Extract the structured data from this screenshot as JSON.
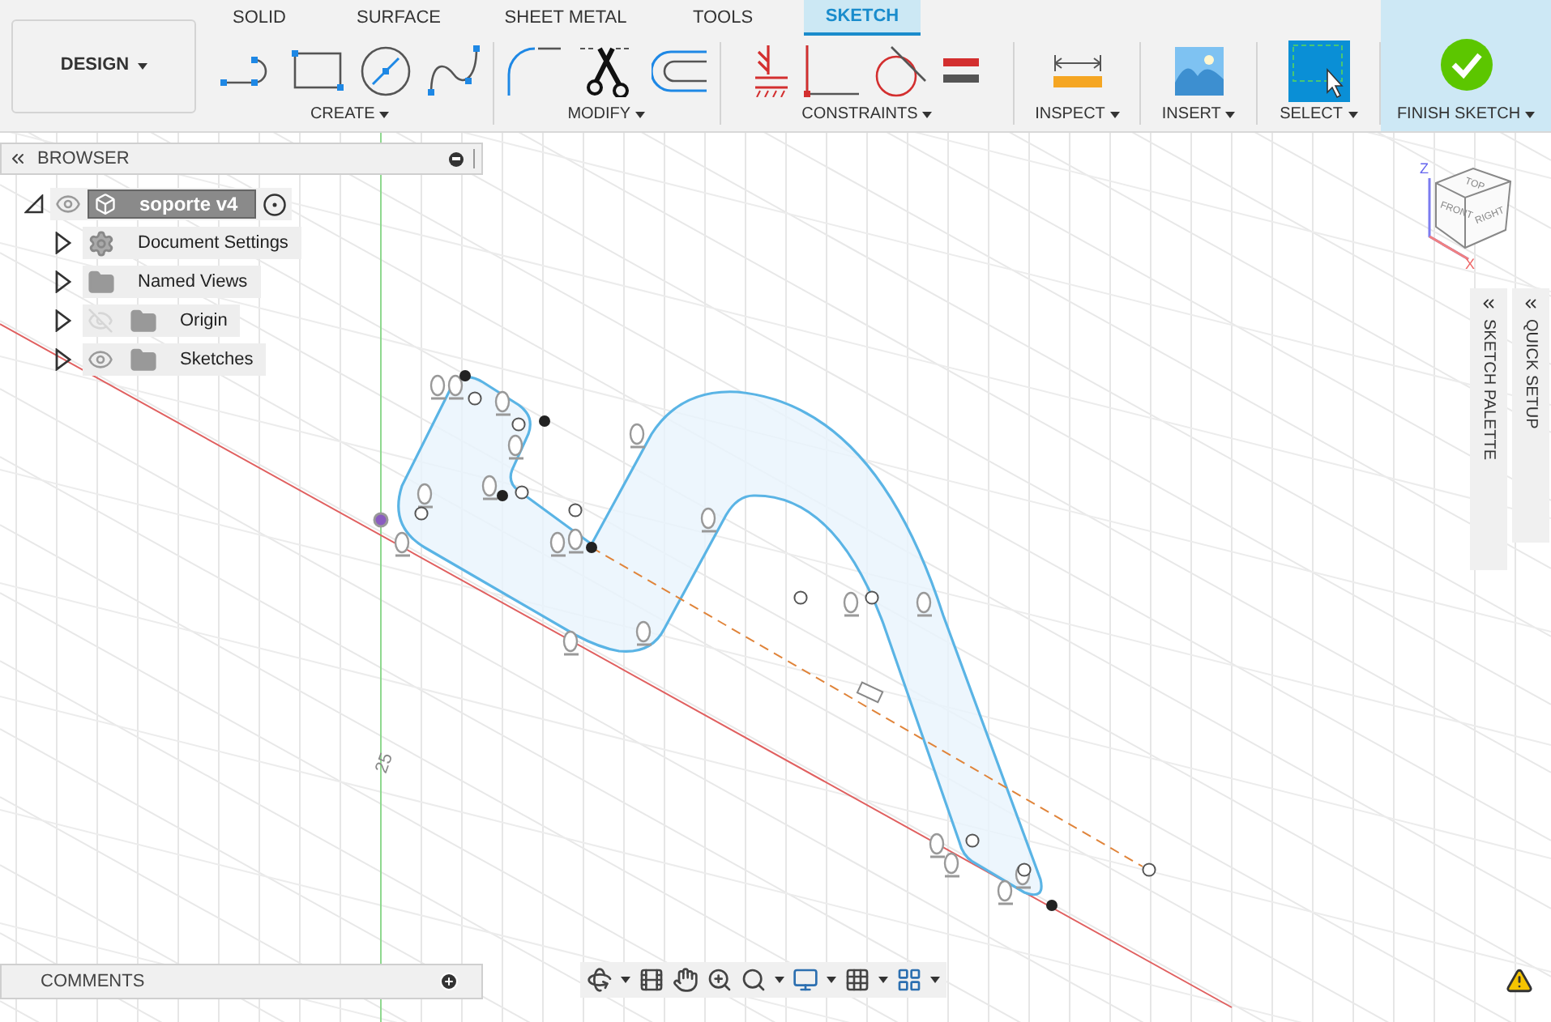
{
  "toolbar": {
    "workspace": "DESIGN",
    "tabs": [
      {
        "label": "SOLID",
        "selected": false
      },
      {
        "label": "SURFACE",
        "selected": false
      },
      {
        "label": "SHEET METAL",
        "selected": false
      },
      {
        "label": "TOOLS",
        "selected": false
      },
      {
        "label": "SKETCH",
        "selected": true
      }
    ],
    "groups": [
      {
        "label": "CREATE"
      },
      {
        "label": "MODIFY"
      },
      {
        "label": "CONSTRAINTS"
      },
      {
        "label": "INSPECT"
      },
      {
        "label": "INSERT"
      },
      {
        "label": "SELECT"
      },
      {
        "label": "FINISH SKETCH"
      }
    ]
  },
  "browser": {
    "title": "BROWSER",
    "root": {
      "label": "soporte v4",
      "expanded": true,
      "visible": true,
      "children": [
        {
          "label": "Document Settings",
          "kind": "settings",
          "expanded": false
        },
        {
          "label": "Named Views",
          "kind": "folder",
          "expanded": false
        },
        {
          "label": "Origin",
          "kind": "folder",
          "expanded": false,
          "visible": false
        },
        {
          "label": "Sketches",
          "kind": "folder",
          "expanded": false,
          "visible": true
        }
      ]
    }
  },
  "view_cube": {
    "faces": [
      "TOP",
      "FRONT",
      "RIGHT"
    ],
    "axes": [
      "Z",
      "X"
    ]
  },
  "palettes": [
    {
      "label": "SKETCH PALETTE"
    },
    {
      "label": "QUICK SETUP"
    }
  ],
  "canvas": {
    "grid_label": "25"
  },
  "comments": {
    "title": "COMMENTS"
  }
}
